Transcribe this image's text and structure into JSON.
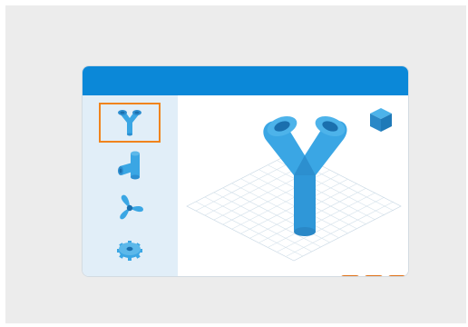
{
  "colors": {
    "titlebar": "#0b88d8",
    "sidebar": "#e1eef8",
    "accent_orange": "#f0841d",
    "model_blue": "#3aa6e4",
    "model_dark": "#1a6fae",
    "grid": "#d7e3ec"
  },
  "sidebar": {
    "items": [
      {
        "icon": "y-pipe-icon",
        "selected": true
      },
      {
        "icon": "elbow-pipe-icon",
        "selected": false
      },
      {
        "icon": "fan-icon",
        "selected": false
      },
      {
        "icon": "gear-icon",
        "selected": false
      }
    ]
  },
  "viewport": {
    "model": "y-pipe-model",
    "view_cube": "view-cube-icon"
  },
  "toolbar": {
    "buttons": [
      {
        "icon": "more-icon",
        "label": "..."
      },
      {
        "icon": "download-icon",
        "label": "↓"
      },
      {
        "icon": "more-icon",
        "label": "..."
      },
      {
        "icon": "more-icon",
        "label": "..."
      }
    ]
  }
}
